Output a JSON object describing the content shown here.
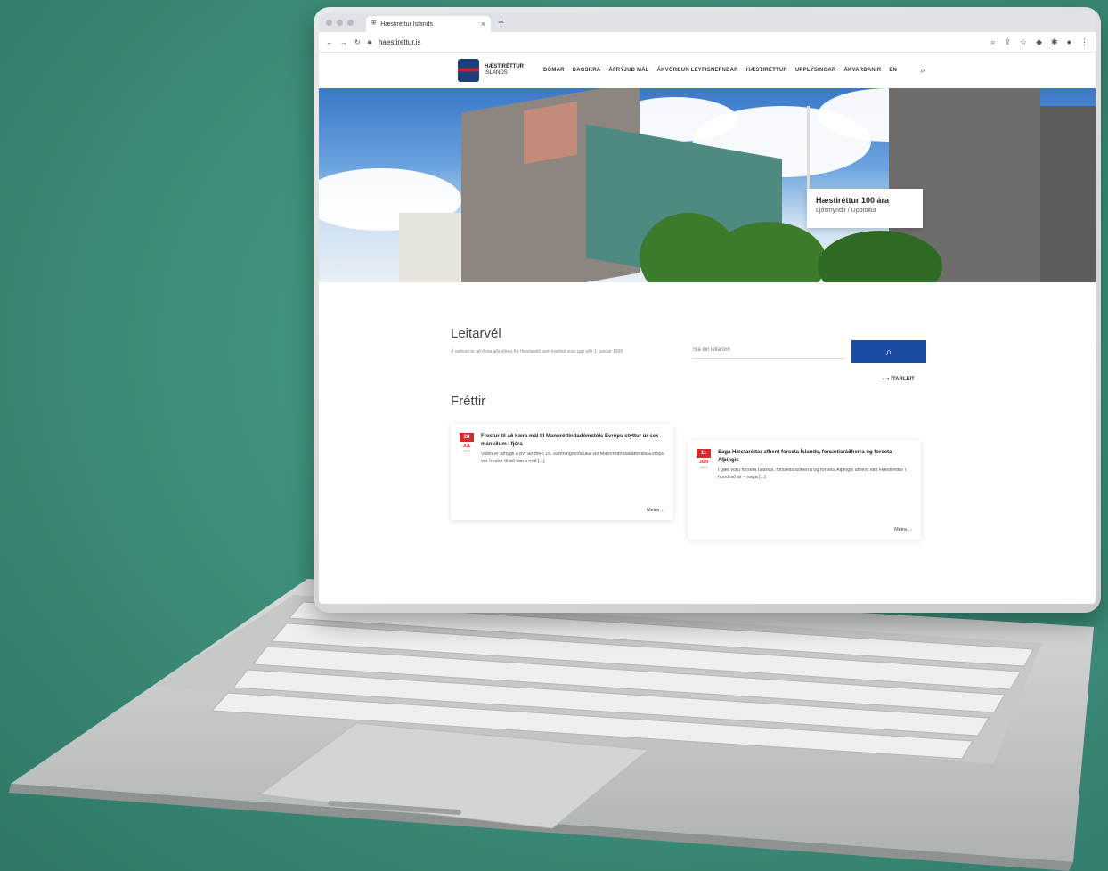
{
  "browser": {
    "tab_title": "Hæstiréttur Íslands",
    "tab_close": "×",
    "new_tab": "+",
    "url": "haestirettur.is"
  },
  "site": {
    "logo_line1": "HÆSTIRÉTTUR",
    "logo_line2": "ÍSLANDS",
    "nav": [
      "DÓMAR",
      "DAGSKRÁ",
      "ÁFRÝJUÐ MÁL",
      "ÁKVÖRÐUN LEYFISNEFNDAR",
      "HÆSTIRÉTTUR",
      "UPPLÝSINGAR",
      "ÁKVARÐANIR",
      "EN"
    ]
  },
  "hero": {
    "caption_title": "Hæstiréttur 100 ára",
    "caption_sub": "Ljósmyndir / Upptökur"
  },
  "search": {
    "title": "Leitarvél",
    "description": "Á vefnum er að finna alla dóma frá Hæstarétti sem kveðnir voru upp eftir 1. janúar 1999",
    "placeholder": "Slá inn leitarorð",
    "advanced": "ÍTARLEIT"
  },
  "news": {
    "title": "Fréttir",
    "items": [
      {
        "day": "28",
        "month": "JÚL",
        "year": "2021",
        "headline": "Frestur til að kæra mál til Mannréttindadómstóls Evrópu styttur úr sex mánuðum í fjóra",
        "body": "Vakin er athygli á því að með 15. samningsviðauka við Mannréttindasáttmála Evrópu var frestur til að kæra mál [...]",
        "more": "Meira ..."
      },
      {
        "day": "11",
        "month": "JÚN",
        "year": "2021",
        "headline": "Saga Hæstaréttar afhent forseta Íslands, forsætisráðherra og forseta Alþingis",
        "body": "Í gær voru forseta Íslands, forsætisráðherra og forseta Alþingis afhent ritið Hæstiréttur í hundrað ár – saga [...]",
        "more": "Meira ..."
      }
    ]
  },
  "colors": {
    "background": "#3f917d",
    "accent": "#1b4aa3",
    "date_red": "#d32a2a"
  }
}
